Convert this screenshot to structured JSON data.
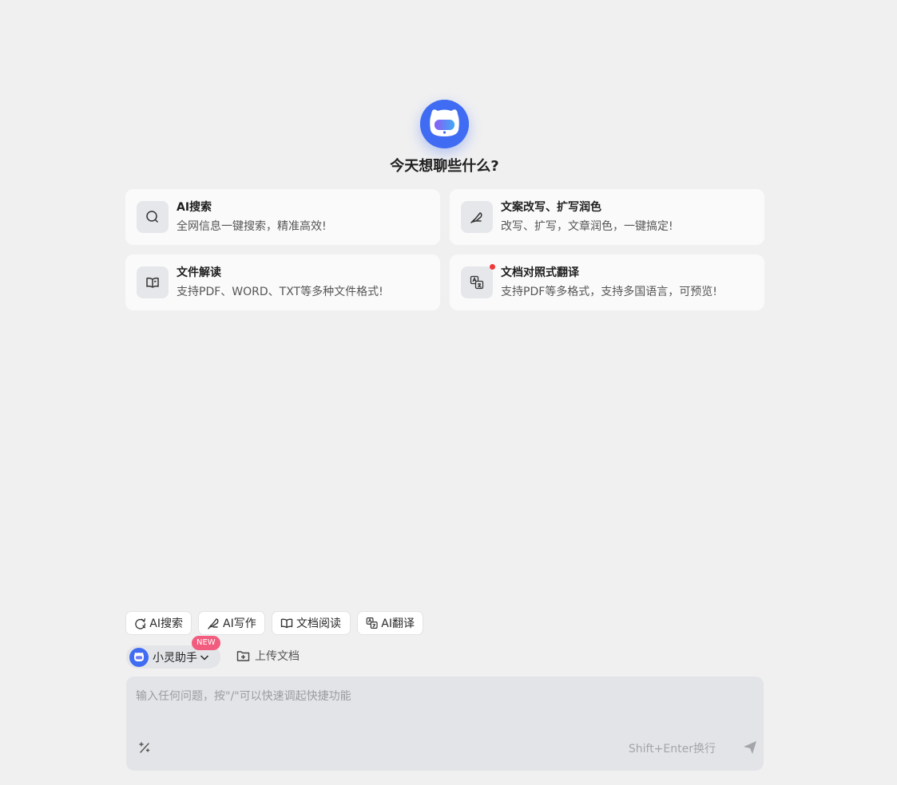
{
  "header": {
    "greeting": "今天想聊些什么?"
  },
  "cards": [
    {
      "title": "AI搜索",
      "desc": "全网信息一键搜索，精准高效!",
      "icon": "search-icon"
    },
    {
      "title": "文案改写、扩写润色",
      "desc": "改写、扩写，文章润色，一键搞定!",
      "icon": "feather-pen-icon"
    },
    {
      "title": "文件解读",
      "desc": "支持PDF、WORD、TXT等多种文件格式!",
      "icon": "book-icon"
    },
    {
      "title": "文档对照式翻译",
      "desc": "支持PDF等多格式，支持多国语言，可预览!",
      "icon": "translate-icon"
    }
  ],
  "quick_actions": [
    {
      "label": "AI搜索",
      "icon": "ai-search-icon"
    },
    {
      "label": "AI写作",
      "icon": "pen-icon"
    },
    {
      "label": "文档阅读",
      "icon": "book-icon"
    },
    {
      "label": "AI翻译",
      "icon": "translate-icon"
    }
  ],
  "model": {
    "name": "小灵助手",
    "badge": "NEW"
  },
  "upload_label": "上传文档",
  "input": {
    "placeholder": "输入任何问题，按\"/\"可以快速调起快捷功能",
    "hint": "Shift+Enter换行"
  },
  "colors": {
    "accent": "#3f6cf2",
    "badge": "#f25c7e",
    "dot": "#f03a3a"
  }
}
